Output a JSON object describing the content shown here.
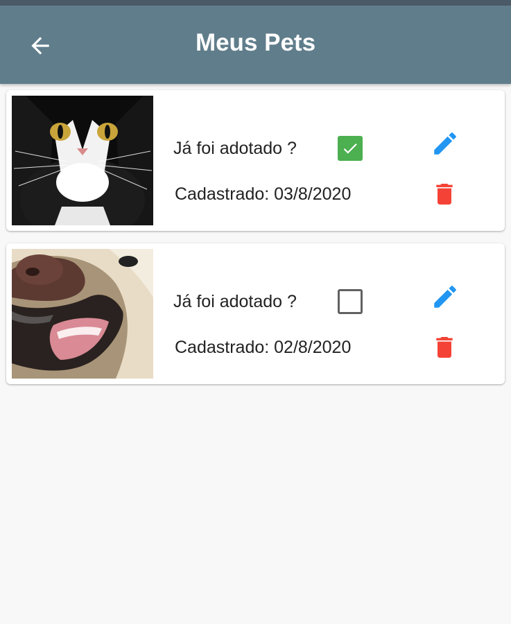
{
  "appbar": {
    "title": "Meus Pets",
    "back_icon": "arrow-back-icon",
    "color": "#607d8b"
  },
  "pets": [
    {
      "photo": "cat-photo",
      "adopted_label": "Já foi adotado ?",
      "adopted": true,
      "registered_label": "Cadastrado: 03/8/2020",
      "edit_icon": "pencil-icon",
      "delete_icon": "trash-icon"
    },
    {
      "photo": "dog-photo",
      "adopted_label": "Já foi adotado ?",
      "adopted": false,
      "registered_label": "Cadastrado: 02/8/2020",
      "edit_icon": "pencil-icon",
      "delete_icon": "trash-icon"
    }
  ],
  "colors": {
    "checkbox_checked": "#4caf50",
    "edit": "#2196f3",
    "delete": "#f44336"
  }
}
